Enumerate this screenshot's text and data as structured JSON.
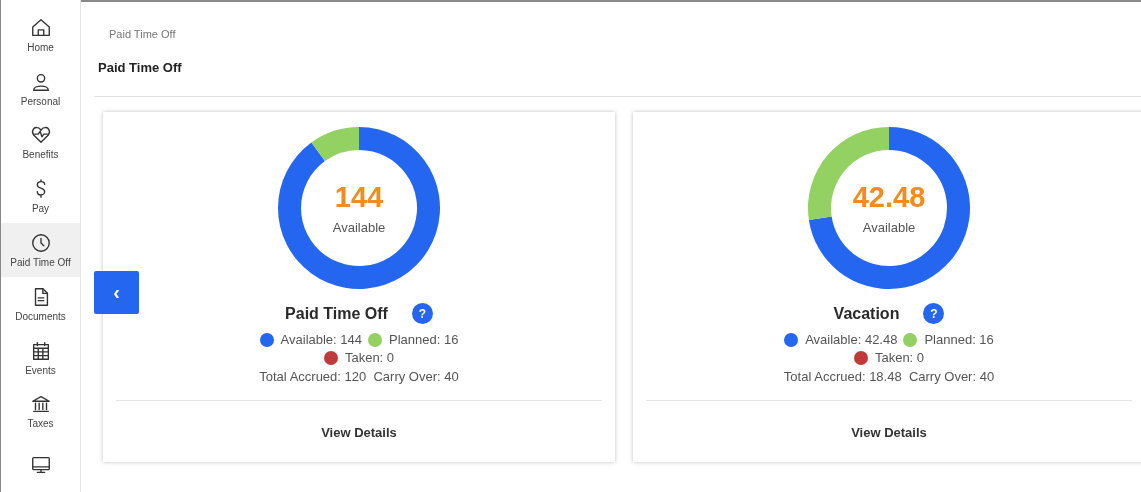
{
  "sidebar": {
    "items": [
      {
        "label": "Home",
        "selected": false
      },
      {
        "label": "Personal",
        "selected": false
      },
      {
        "label": "Benefits",
        "selected": false
      },
      {
        "label": "Pay",
        "selected": false
      },
      {
        "label": "Paid Time Off",
        "selected": true
      },
      {
        "label": "Documents",
        "selected": false
      },
      {
        "label": "Events",
        "selected": false
      },
      {
        "label": "Taxes",
        "selected": false
      },
      {
        "selected": false
      }
    ]
  },
  "breadcrumb": "Paid Time Off",
  "page_title": "Paid Time Off",
  "back_button": "‹",
  "cards": [
    {
      "total": "144",
      "total_label": "Available",
      "help": "?",
      "chart_data": {
        "type": "donut",
        "title": "Paid Time Off",
        "categories": [
          "Available: 144",
          "Planned: 16",
          "Taken: 0"
        ],
        "series": [
          {
            "values": [
              144,
              16,
              0
            ]
          }
        ],
        "colors": [
          "#2566f0",
          "#93d162",
          "#bf3b3b"
        ]
      },
      "summary": "Total Accrued: 120  Carry Over: 40",
      "link": "View Details"
    },
    {
      "total": "42.48",
      "total_label": "Available",
      "help": "?",
      "chart_data": {
        "type": "donut",
        "title": "Vacation",
        "categories": [
          "Available: 42.48",
          "Planned: 16",
          "Taken: 0"
        ],
        "series": [
          {
            "values": [
              42.48,
              16,
              0
            ]
          }
        ],
        "colors": [
          "#2566f0",
          "#93d162",
          "#bf3b3b"
        ]
      },
      "summary": "Total Accrued: 18.48  Carry Over: 40",
      "link": "View Details"
    }
  ]
}
